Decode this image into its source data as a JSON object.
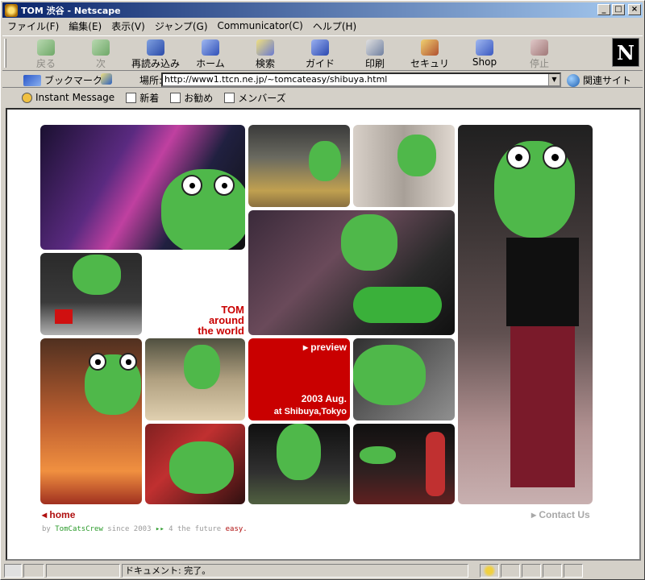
{
  "window": {
    "title": "TOM 渋谷 - Netscape",
    "controls": [
      "_",
      "□",
      "×"
    ]
  },
  "menu": [
    "ファイル(F)",
    "編集(E)",
    "表示(V)",
    "ジャンプ(G)",
    "Communicator(C)",
    "ヘルプ(H)"
  ],
  "nav": {
    "back": "戻る",
    "forward": "次",
    "reload": "再読み込み",
    "home": "ホーム",
    "search": "検索",
    "guide": "ガイド",
    "print": "印刷",
    "security": "セキュリティ",
    "shop": "Shop",
    "stop": "停止"
  },
  "location": {
    "bookmarks_label": "ブックマーク",
    "location_label": "場所:",
    "url": "http://www1.ttcn.ne.jp/~tomcateasy/shibuya.html",
    "related_label": "関連サイト"
  },
  "personal": [
    "Instant Message",
    "新着",
    "お勧め",
    "メンバーズ"
  ],
  "page": {
    "title_lines": [
      "TOM",
      "around",
      "the world"
    ],
    "preview_label": "preview",
    "date_line": "2003 Aug.",
    "place_line": "at Shibuya,Tokyo",
    "home_link": "home",
    "contact_link": "Contact Us",
    "footer": {
      "by": "by",
      "crew": "TomCatsCrew",
      "since": "since 2003",
      "future": "4 the future",
      "easy": "easy."
    }
  },
  "status": {
    "text": "ドキュメント: 完了。"
  },
  "colors": {
    "accent_red": "#c90000",
    "frog_green": "#4fb84a"
  }
}
